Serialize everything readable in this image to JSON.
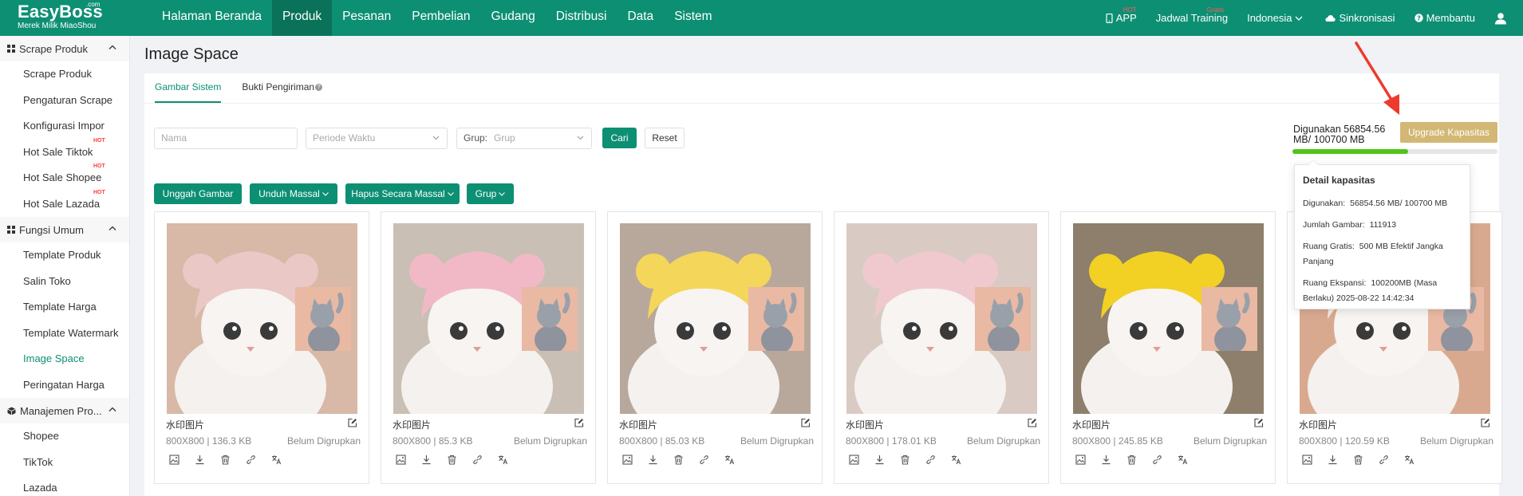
{
  "brand": {
    "name": "EasyBoss",
    "com": ".com",
    "tagline": "Merek Milik MiaoShou"
  },
  "nav": {
    "items": [
      "Halaman Beranda",
      "Produk",
      "Pesanan",
      "Pembelian",
      "Gudang",
      "Distribusi",
      "Data",
      "Sistem"
    ],
    "active": "Produk",
    "right": {
      "app": "APP",
      "app_badge": "HOT",
      "training": "Jadwal Training",
      "training_badge": "Gratis",
      "language": "Indonesia",
      "sync": "Sinkronisasi",
      "help": "Membantu"
    }
  },
  "sidebar": {
    "groups": [
      {
        "label": "Scrape Produk",
        "items": [
          {
            "label": "Scrape Produk"
          },
          {
            "label": "Pengaturan Scrape"
          },
          {
            "label": "Konfigurasi Impor"
          },
          {
            "label": "Hot Sale Tiktok",
            "badge": "HOT"
          },
          {
            "label": "Hot Sale Shopee",
            "badge": "HOT"
          },
          {
            "label": "Hot Sale Lazada",
            "badge": "HOT"
          }
        ]
      },
      {
        "label": "Fungsi Umum",
        "items": [
          {
            "label": "Template Produk"
          },
          {
            "label": "Salin Toko"
          },
          {
            "label": "Template Harga"
          },
          {
            "label": "Template Watermark"
          },
          {
            "label": "Image Space",
            "active": true
          },
          {
            "label": "Peringatan Harga"
          }
        ]
      },
      {
        "label": "Manajemen Pro...",
        "items": [
          {
            "label": "Shopee"
          },
          {
            "label": "TikTok"
          },
          {
            "label": "Lazada"
          }
        ]
      }
    ]
  },
  "page": {
    "title": "Image Space",
    "tabs": [
      "Gambar Sistem",
      "Bukti Pengiriman"
    ],
    "active_tab": "Gambar Sistem"
  },
  "filters": {
    "name_placeholder": "Nama",
    "period_placeholder": "Periode Waktu",
    "group_label": "Grup:",
    "group_placeholder": "Grup",
    "search": "Cari",
    "reset": "Reset"
  },
  "capacity": {
    "used_text": "Digunakan 56854.56 MB/ 100700 MB",
    "upgrade": "Upgrade Kapasitas",
    "used_fraction": 0.5646
  },
  "actions": {
    "upload": "Unggah Gambar",
    "bulk_download": "Unduh Massal",
    "bulk_delete": "Hapus Secara Massal",
    "group": "Grup"
  },
  "popover": {
    "title": "Detail kapasitas",
    "used_k": "Digunakan:",
    "used_v": "56854.56 MB/ 100700 MB",
    "count_k": "Jumlah Gambar:",
    "count_v": "111913",
    "free_k": "Ruang Gratis:",
    "free_v": "500 MB Efektif Jangka Panjang",
    "exp_k": "Ruang Ekspansi:",
    "exp_v": "100200MB (Masa Berlaku) 2025-08-22 14:42:34"
  },
  "cards": [
    {
      "name": "水印图片",
      "meta": "800X800 | 136.3 KB",
      "status": "Belum Digrupkan",
      "bg": "#d8b8a6",
      "hat": "#e9c8c6"
    },
    {
      "name": "水印图片",
      "meta": "800X800 | 85.3 KB",
      "status": "Belum Digrupkan",
      "bg": "#c9bfb4",
      "hat": "#f1b9c6"
    },
    {
      "name": "水印图片",
      "meta": "800X800 | 85.03 KB",
      "status": "Belum Digrupkan",
      "bg": "#b8a89c",
      "hat": "#f4d65a"
    },
    {
      "name": "水印图片",
      "meta": "800X800 | 178.01 KB",
      "status": "Belum Digrupkan",
      "bg": "#d9cbc3",
      "hat": "#f0c9cf"
    },
    {
      "name": "水印图片",
      "meta": "800X800 | 245.85 KB",
      "status": "Belum Digrupkan",
      "bg": "#8d7f6b",
      "hat": "#f2d024"
    },
    {
      "name": "水印图片",
      "meta": "800X800 | 120.59 KB",
      "status": "Belum Digrupkan",
      "bg": "#d9a98f",
      "hat": "#f3ece6"
    }
  ]
}
